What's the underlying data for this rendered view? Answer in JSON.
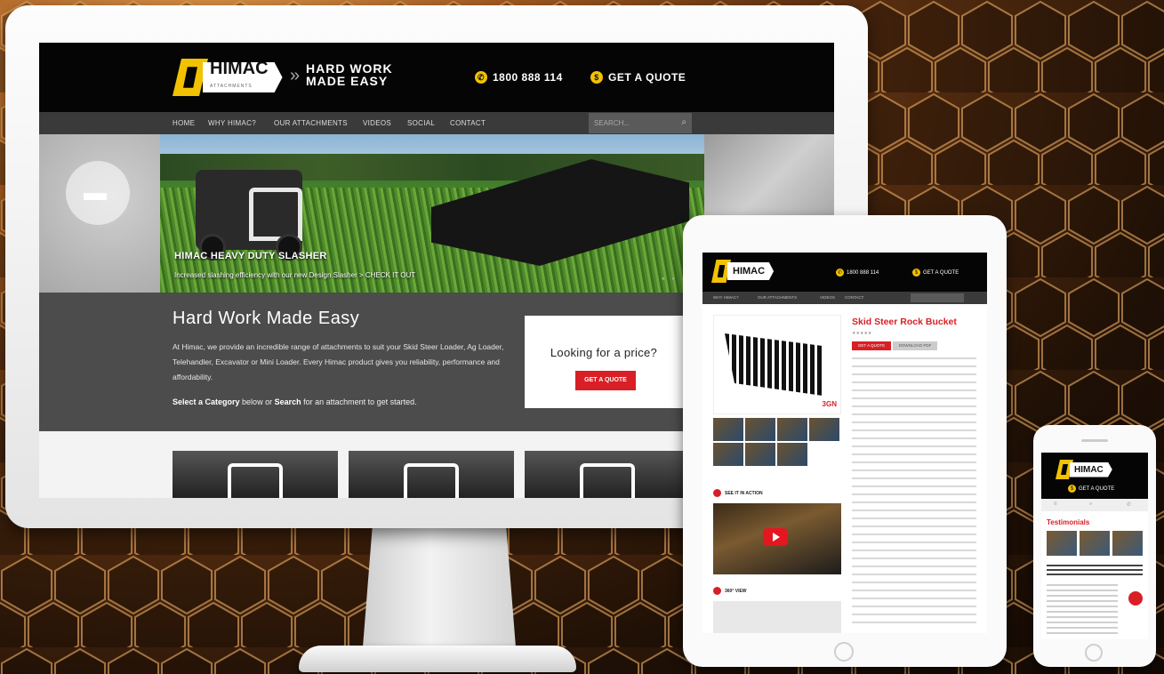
{
  "colors": {
    "brand_yellow": "#f2c200",
    "brand_red": "#d81f26",
    "header_bg": "#050505",
    "nav_bg": "#3a3a3a",
    "intro_bg": "#4c4c4c"
  },
  "desktop": {
    "logo": {
      "name": "HIMAC",
      "sub": "ATTACHMENTS"
    },
    "tagline_1": "HARD WORK",
    "tagline_2": "MADE EASY",
    "phone": "1800 888 114",
    "quote": "GET A QUOTE",
    "nav": [
      "HOME",
      "WHY HIMAC?",
      "OUR ATTACHMENTS",
      "VIDEOS",
      "SOCIAL",
      "CONTACT"
    ],
    "search_placeholder": "SEARCH...",
    "hero": {
      "title": "HIMAC HEAVY DUTY SLASHER",
      "subtitle": "Increased slashing efficiency with our new Design Slasher",
      "cta": "CHECK IT OUT"
    },
    "intro": {
      "heading": "Hard Work Made Easy",
      "paragraph": "At Himac, we provide an incredible range of attachments to suit your Skid Steer Loader, Ag Loader, Telehandler, Excavator or Mini Loader. Every Himac product gives you reliability, performance and affordability.",
      "select_bold_1": "Select a Category",
      "select_mid": " below or ",
      "select_bold_2": "Search",
      "select_end": " for an attachment to get started."
    },
    "price_card": {
      "question": "Looking for a price?",
      "button": "GET A QUOTE"
    }
  },
  "tablet": {
    "logo": "HIMAC",
    "phone": "1800 888 114",
    "quote": "GET A QUOTE",
    "nav": [
      "WHY HIMAC?",
      "OUR ATTACHMENTS",
      "VIDEOS",
      "CONTACT"
    ],
    "product_title": "Skid Steer Rock Bucket",
    "brand_badge": "3GN",
    "btn_quote": "GET A QUOTE",
    "btn_download": "DOWNLOAD PDF",
    "section_action": "SEE IT IN ACTION",
    "section_360": "360° VIEW"
  },
  "phone": {
    "logo": "HIMAC",
    "quote": "GET A QUOTE",
    "section_title": "Testimonials"
  }
}
